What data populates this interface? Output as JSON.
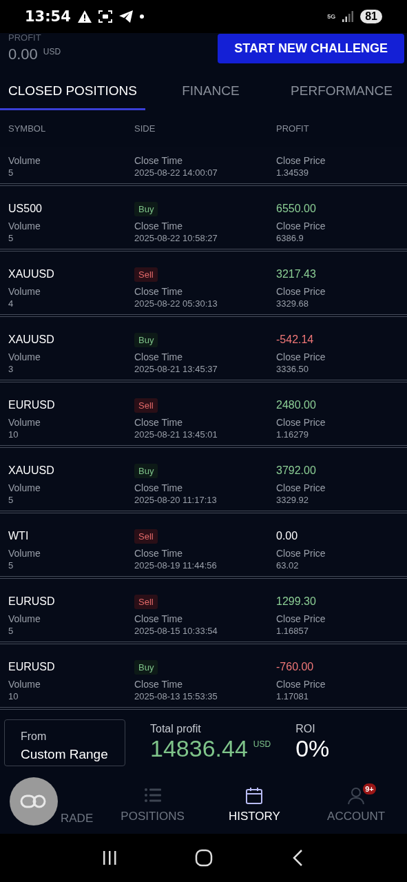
{
  "status_bar": {
    "time": "13:54",
    "network": "5G",
    "battery": "81"
  },
  "header": {
    "profit_label": "PROFIT",
    "profit_value": "0.00",
    "currency": "USD",
    "button": "START NEW CHALLENGE"
  },
  "tabs": [
    {
      "label": "CLOSED POSITIONS",
      "selected": true
    },
    {
      "label": "FINANCE",
      "selected": false
    },
    {
      "label": "PERFORMANCE",
      "selected": false
    }
  ],
  "table": {
    "columns": [
      "SYMBOL",
      "SIDE",
      "PROFIT"
    ],
    "rows": [
      {
        "volume_label": "Volume",
        "volume": "5",
        "time_label": "Close Time",
        "close_time": "2025-08-22 14:00:07",
        "price_label": "Close Price",
        "close_price": "1.34539"
      },
      {
        "symbol": "US500",
        "side": "Buy",
        "kind": "buy",
        "profit": "6550.00",
        "color": "#8ccf95",
        "volume_label": "Volume",
        "volume": "5",
        "time_label": "Close Time",
        "close_time": "2025-08-22 10:58:27",
        "price_label": "Close Price",
        "close_price": "6386.9"
      },
      {
        "symbol": "XAUUSD",
        "side": "Sell",
        "kind": "sell",
        "profit": "3217.43",
        "color": "#8ccf95",
        "volume_label": "Volume",
        "volume": "4",
        "time_label": "Close Time",
        "close_time": "2025-08-22 05:30:13",
        "price_label": "Close Price",
        "close_price": "3329.68"
      },
      {
        "symbol": "XAUUSD",
        "side": "Buy",
        "kind": "buy",
        "profit": "-542.14",
        "color": "#f07777",
        "volume_label": "Volume",
        "volume": "3",
        "time_label": "Close Time",
        "close_time": "2025-08-21 13:45:37",
        "price_label": "Close Price",
        "close_price": "3336.50"
      },
      {
        "symbol": "EURUSD",
        "side": "Sell",
        "kind": "sell",
        "profit": "2480.00",
        "color": "#8ccf95",
        "volume_label": "Volume",
        "volume": "10",
        "time_label": "Close Time",
        "close_time": "2025-08-21 13:45:01",
        "price_label": "Close Price",
        "close_price": "1.16279"
      },
      {
        "symbol": "XAUUSD",
        "side": "Buy",
        "kind": "buy",
        "profit": "3792.00",
        "color": "#8ccf95",
        "volume_label": "Volume",
        "volume": "5",
        "time_label": "Close Time",
        "close_time": "2025-08-20 11:17:13",
        "price_label": "Close Price",
        "close_price": "3329.92"
      },
      {
        "symbol": "WTI",
        "side": "Sell",
        "kind": "sell",
        "profit": "0.00",
        "color": "#ffffff",
        "volume_label": "Volume",
        "volume": "5",
        "time_label": "Close Time",
        "close_time": "2025-08-19 11:44:56",
        "price_label": "Close Price",
        "close_price": "63.02"
      },
      {
        "symbol": "EURUSD",
        "side": "Sell",
        "kind": "sell",
        "profit": "1299.30",
        "color": "#8ccf95",
        "volume_label": "Volume",
        "volume": "5",
        "time_label": "Close Time",
        "close_time": "2025-08-15 10:33:54",
        "price_label": "Close Price",
        "close_price": "1.16857"
      },
      {
        "symbol": "EURUSD",
        "side": "Buy",
        "kind": "buy",
        "profit": "-760.00",
        "color": "#f07777",
        "volume_label": "Volume",
        "volume": "10",
        "time_label": "Close Time",
        "close_time": "2025-08-13 15:53:35",
        "price_label": "Close Price",
        "close_price": "1.17081"
      }
    ]
  },
  "summary": {
    "range_label": "From",
    "range_value": "Custom Range",
    "total_label": "Total profit",
    "total_value": "14836.44",
    "currency": "USD",
    "roi_label": "ROI",
    "roi_value": "0%"
  },
  "nav": [
    {
      "kind": "trade",
      "label": "RADE",
      "selected": false
    },
    {
      "kind": "positions",
      "label": "POSITIONS",
      "selected": false
    },
    {
      "kind": "history",
      "label": "HISTORY",
      "selected": true
    },
    {
      "kind": "account",
      "label": "ACCOUNT",
      "selected": false,
      "badge": "9+"
    }
  ]
}
